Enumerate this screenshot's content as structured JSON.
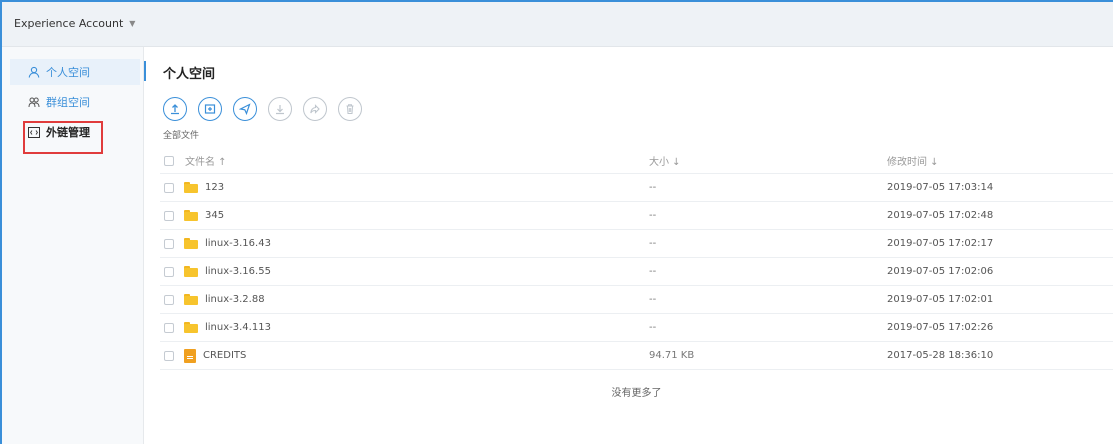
{
  "account": {
    "label": "Experience Account",
    "caret": "▼"
  },
  "sidebar": {
    "items": [
      {
        "label": "个人空间",
        "icon": "user-icon"
      },
      {
        "label": "群组空间",
        "icon": "group-icon"
      },
      {
        "label": "外链管理",
        "icon": "link-code-icon"
      }
    ]
  },
  "main": {
    "title": "个人空间",
    "breadcrumb": "全部文件",
    "toolbar": [
      {
        "name": "upload",
        "icon": "upload-icon",
        "enabled": true
      },
      {
        "name": "new-folder",
        "icon": "new-folder-icon",
        "enabled": true
      },
      {
        "name": "send",
        "icon": "send-icon",
        "enabled": true
      },
      {
        "name": "download",
        "icon": "download-icon",
        "enabled": false
      },
      {
        "name": "share",
        "icon": "share-icon",
        "enabled": false
      },
      {
        "name": "delete",
        "icon": "trash-icon",
        "enabled": false
      }
    ],
    "columns": {
      "name": "文件名 ↑",
      "size": "大小 ↓",
      "time": "修改时间 ↓"
    },
    "rows": [
      {
        "name": "123",
        "type": "folder",
        "size": "--",
        "time": "2019-07-05 17:03:14"
      },
      {
        "name": "345",
        "type": "folder",
        "size": "--",
        "time": "2019-07-05 17:02:48"
      },
      {
        "name": "linux-3.16.43",
        "type": "folder",
        "size": "--",
        "time": "2019-07-05 17:02:17"
      },
      {
        "name": "linux-3.16.55",
        "type": "folder",
        "size": "--",
        "time": "2019-07-05 17:02:06"
      },
      {
        "name": "linux-3.2.88",
        "type": "folder",
        "size": "--",
        "time": "2019-07-05 17:02:01"
      },
      {
        "name": "linux-3.4.113",
        "type": "folder",
        "size": "--",
        "time": "2019-07-05 17:02:26"
      },
      {
        "name": "CREDITS",
        "type": "file",
        "size": "94.71 KB",
        "time": "2017-05-28 18:36:10"
      }
    ],
    "footer": "没有更多了"
  },
  "colors": {
    "accent": "#3a8fd9",
    "highlight": "#e03c3c",
    "folder": "#f7c42d"
  }
}
